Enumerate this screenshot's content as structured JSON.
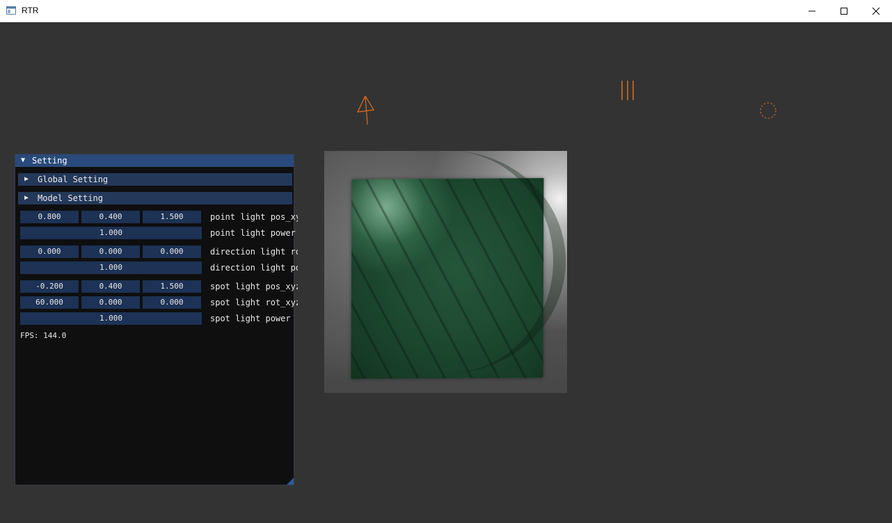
{
  "window": {
    "title": "RTR",
    "minimize_icon": "minimize-icon",
    "maximize_icon": "maximize-icon",
    "close_icon": "close-icon"
  },
  "gizmos": {
    "color": "#e07020",
    "items": [
      "spot-light-gizmo",
      "direction-light-gizmo",
      "point-light-gizmo"
    ]
  },
  "panel": {
    "title": "Setting",
    "expanded_icon": "triangle-down-icon",
    "collapsed_icon": "triangle-right-icon",
    "sections": [
      {
        "label": "Global Setting"
      },
      {
        "label": "Model Setting"
      }
    ],
    "rows": [
      {
        "values": [
          "0.800",
          "0.400",
          "1.500"
        ],
        "label": "point light pos_xyz"
      },
      {
        "values": [
          "1.000"
        ],
        "label": "point light power"
      },
      {
        "values": [
          "0.000",
          "0.000",
          "0.000"
        ],
        "label": "direction light rot_xyz"
      },
      {
        "values": [
          "1.000"
        ],
        "label": "direction light power"
      },
      {
        "values": [
          "-0.200",
          "0.400",
          "1.500"
        ],
        "label": "spot light pos_xyz"
      },
      {
        "values": [
          "60.000",
          "0.000",
          "0.000"
        ],
        "label": "spot light rot_xyz"
      },
      {
        "values": [
          "1.000"
        ],
        "label": "spot light power"
      }
    ],
    "fps": "FPS: 144.0"
  },
  "colors": {
    "background": "#333333",
    "panel_title": "#294a7a",
    "section_header": "#24385a",
    "field": "#1d3255",
    "cloth": "#1e4a31"
  }
}
